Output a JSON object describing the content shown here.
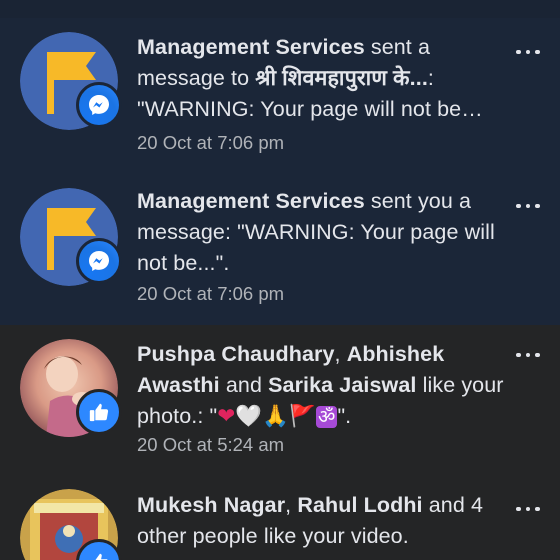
{
  "notifications": [
    {
      "actor": "Management Services",
      "text1": " sent a message to ",
      "target": "श्री शिवमहापुराण के...",
      "text2": ": \"WARNING: Your page will not be…",
      "time": "20 Oct at 7:06 pm",
      "badge": "messenger-icon",
      "state": "unread"
    },
    {
      "actor": "Management Services",
      "text1": " sent you a message: \"WARNING: Your page will not be...\".",
      "time": "20 Oct at 7:06 pm",
      "badge": "messenger-icon",
      "state": "unread"
    },
    {
      "actor1": "Pushpa Chaudhary",
      "sep1": ", ",
      "actor2": "Abhishek Awasthi",
      "sep2": " and ",
      "actor3": "Sarika Jaiswal",
      "text1": " like your photo.: \"",
      "emoji": [
        "❤",
        "🤍",
        "🙏",
        "🚩",
        "ॐ"
      ],
      "text2": "\".",
      "time": "20 Oct at 5:24 am",
      "badge": "like-icon",
      "state": "read"
    },
    {
      "actor1": "Mukesh Nagar",
      "sep1": ", ",
      "actor2": "Rahul Lodhi",
      "text1": " and 4 other people like your video.",
      "badge": "like-icon",
      "state": "read"
    }
  ],
  "colors": {
    "unread_bg": "#1b2638",
    "read_bg": "#242526",
    "badge_blue": "#2d88ff",
    "flag_yellow": "#f7b928",
    "page_avatar_bg": "#4267b2"
  }
}
